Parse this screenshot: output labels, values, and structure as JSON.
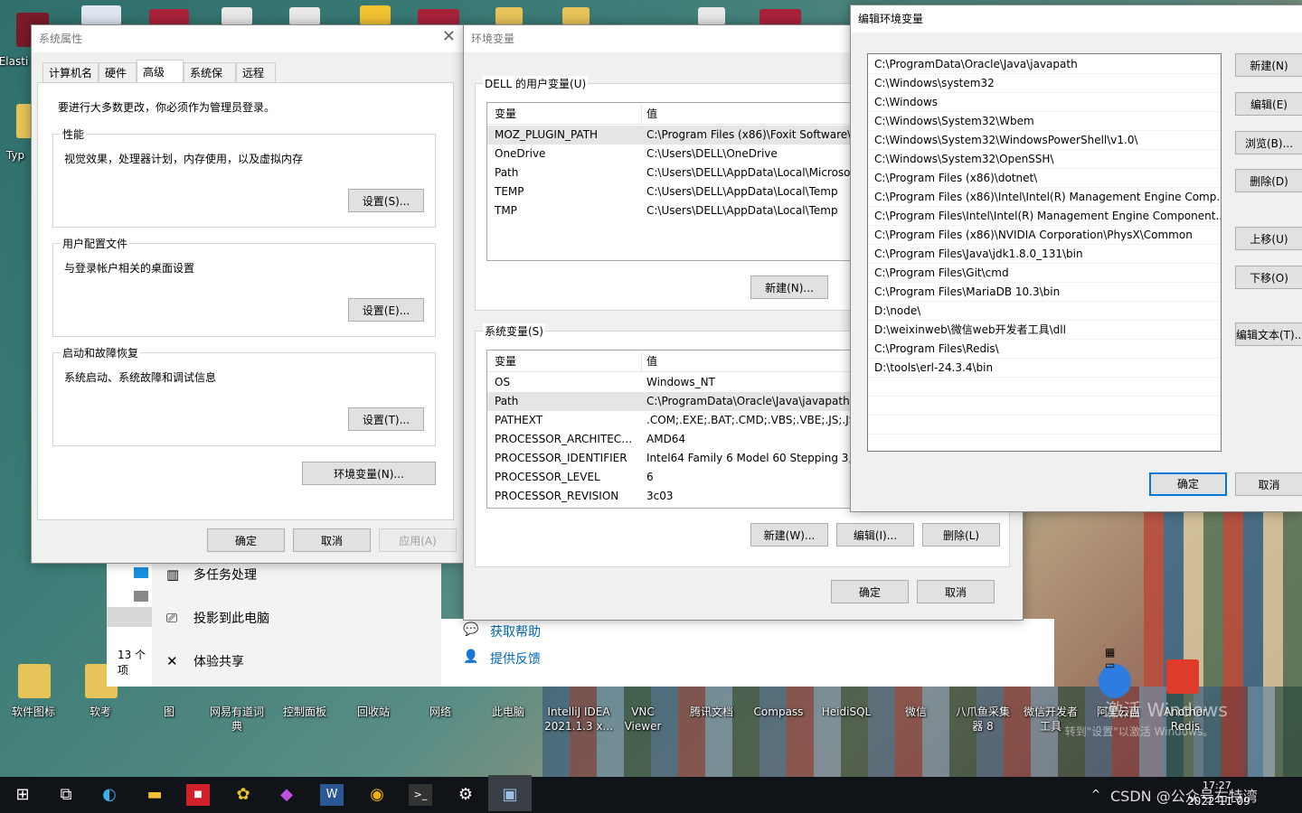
{
  "desktop": {
    "top_labels": {
      "elastic": "Elasti",
      "typ": "Typ"
    },
    "bottom_icons": [
      {
        "label": "软件图标"
      },
      {
        "label": "软考"
      },
      {
        "label": "图"
      },
      {
        "label": "网易有道词典"
      },
      {
        "label": "控制面板"
      },
      {
        "label": "回收站"
      },
      {
        "label": "网络"
      },
      {
        "label": "此电脑"
      },
      {
        "label": "IntelliJ IDEA 2021.1.3 x..."
      },
      {
        "label": "VNC Viewer"
      },
      {
        "label": "腾讯文档"
      },
      {
        "label": "Compass"
      },
      {
        "label": "HeidiSQL"
      },
      {
        "label": "微信"
      },
      {
        "label": "八爪鱼采集器 8"
      },
      {
        "label": "微信开发者工具"
      },
      {
        "label": "阿里云盘"
      },
      {
        "label": "Another Redis"
      }
    ],
    "watermark": "激活 Windows",
    "watermark_sub": "转到\"设置\"以激活 Windows。"
  },
  "sysprops": {
    "title": "系统属性",
    "tabs": [
      "计算机名",
      "硬件",
      "高级",
      "系统保护",
      "远程"
    ],
    "active_tab": "高级",
    "admin_note": "要进行大多数更改，你必须作为管理员登录。",
    "performance": {
      "label": "性能",
      "desc": "视觉效果，处理器计划，内存使用，以及虚拟内存",
      "button": "设置(S)..."
    },
    "profiles": {
      "label": "用户配置文件",
      "desc": "与登录帐户相关的桌面设置",
      "button": "设置(E)..."
    },
    "startup": {
      "label": "启动和故障恢复",
      "desc": "系统启动、系统故障和调试信息",
      "button": "设置(T)..."
    },
    "env_button": "环境变量(N)...",
    "ok": "确定",
    "cancel": "取消",
    "apply": "应用(A)"
  },
  "envvars": {
    "title": "环境变量",
    "user_label": "DELL 的用户变量(U)",
    "col_var": "变量",
    "col_val": "值",
    "user_rows": [
      {
        "name": "MOZ_PLUGIN_PATH",
        "value": "C:\\Program Files (x86)\\Foxit Software\\F"
      },
      {
        "name": "OneDrive",
        "value": "C:\\Users\\DELL\\OneDrive"
      },
      {
        "name": "Path",
        "value": "C:\\Users\\DELL\\AppData\\Local\\Microso"
      },
      {
        "name": "TEMP",
        "value": "C:\\Users\\DELL\\AppData\\Local\\Temp"
      },
      {
        "name": "TMP",
        "value": "C:\\Users\\DELL\\AppData\\Local\\Temp"
      }
    ],
    "user_new": "新建(N)...",
    "sys_label": "系统变量(S)",
    "sys_rows": [
      {
        "name": "OS",
        "value": "Windows_NT"
      },
      {
        "name": "Path",
        "value": "C:\\ProgramData\\Oracle\\Java\\javapath;"
      },
      {
        "name": "PATHEXT",
        "value": ".COM;.EXE;.BAT;.CMD;.VBS;.VBE;.JS;.JSE"
      },
      {
        "name": "PROCESSOR_ARCHITECT...",
        "value": "AMD64"
      },
      {
        "name": "PROCESSOR_IDENTIFIER",
        "value": "Intel64 Family 6 Model 60 Stepping 3,"
      },
      {
        "name": "PROCESSOR_LEVEL",
        "value": "6"
      },
      {
        "name": "PROCESSOR_REVISION",
        "value": "3c03"
      }
    ],
    "sys_new": "新建(W)...",
    "sys_edit": "编辑(I)...",
    "sys_delete": "删除(L)",
    "ok": "确定",
    "cancel": "取消"
  },
  "editenv": {
    "title": "编辑环境变量",
    "paths": [
      "C:\\ProgramData\\Oracle\\Java\\javapath",
      "C:\\Windows\\system32",
      "C:\\Windows",
      "C:\\Windows\\System32\\Wbem",
      "C:\\Windows\\System32\\WindowsPowerShell\\v1.0\\",
      "C:\\Windows\\System32\\OpenSSH\\",
      "C:\\Program Files (x86)\\dotnet\\",
      "C:\\Program Files (x86)\\Intel\\Intel(R) Management Engine Comp...",
      "C:\\Program Files\\Intel\\Intel(R) Management Engine Component...",
      "C:\\Program Files (x86)\\NVIDIA Corporation\\PhysX\\Common",
      "C:\\Program Files\\Java\\jdk1.8.0_131\\bin",
      "C:\\Program Files\\Git\\cmd",
      "C:\\Program Files\\MariaDB 10.3\\bin",
      "D:\\node\\",
      "D:\\weixinweb\\微信web开发者工具\\dll",
      "C:\\Program Files\\Redis\\",
      "D:\\tools\\erl-24.3.4\\bin"
    ],
    "btn_new": "新建(N)",
    "btn_edit": "编辑(E)",
    "btn_browse": "浏览(B)...",
    "btn_delete": "删除(D)",
    "btn_up": "上移(U)",
    "btn_down": "下移(O)",
    "btn_edittext": "编辑文本(T)...",
    "ok": "确定",
    "cancel": "取消"
  },
  "settings": {
    "multitask": "多任务处理",
    "project": "投影到此电脑",
    "share": "体验共享",
    "count": "13 个项"
  },
  "help": {
    "get_help": "获取帮助",
    "feedback": "提供反馈"
  },
  "tray": {
    "csdn": "CSDN @公众号右特湾",
    "time": "17:27",
    "date": "2022-11-09"
  }
}
